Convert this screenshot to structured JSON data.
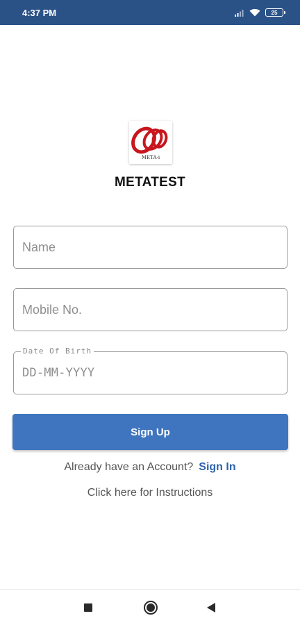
{
  "status_bar": {
    "time": "4:37 PM",
    "battery_level": "25",
    "icons": [
      "signal-icon",
      "wifi-icon",
      "battery-icon"
    ]
  },
  "app": {
    "logo_text": "META-i",
    "title": "METATEST"
  },
  "form": {
    "name_placeholder": "Name",
    "mobile_placeholder": "Mobile No.",
    "dob_label": "Date Of Birth",
    "dob_placeholder": "DD-MM-YYYY",
    "signup_label": "Sign Up"
  },
  "footer": {
    "account_prompt": "Already have an Account?",
    "signin_label": "Sign In",
    "instructions_label": "Click here for Instructions"
  },
  "nav": {
    "icons": [
      "recents-square-icon",
      "home-circle-icon",
      "back-triangle-icon"
    ]
  },
  "colors": {
    "status_bar": "#2b5287",
    "primary_button": "#3f75bf",
    "link": "#2e64ad",
    "logo_red": "#c8161d"
  }
}
